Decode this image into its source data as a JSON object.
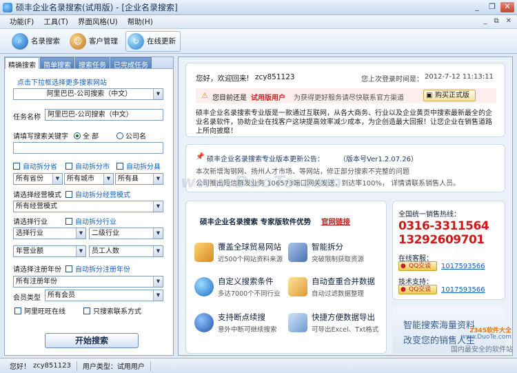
{
  "window": {
    "title": "硕丰企业名录搜索(试用版) - [企业名录搜索]"
  },
  "window_controls": {
    "minimize": "_",
    "restore": "❐",
    "close": "✕"
  },
  "menu": {
    "items": [
      "功能(F)",
      "工具(T)",
      "界面风格(U)",
      "帮助(H)"
    ],
    "right_controls": {
      "minimize": "_",
      "restore": "⧉",
      "close": "✕"
    }
  },
  "toolbar": {
    "buttons": [
      {
        "label": "名录搜索",
        "icon": "search-globe-icon"
      },
      {
        "label": "客户管理",
        "icon": "customers-icon"
      },
      {
        "label": "在线更新",
        "icon": "update-globe-icon"
      }
    ]
  },
  "left": {
    "tabs": [
      "精确搜索",
      "简单搜索",
      "搜索任务",
      "已完成任务"
    ],
    "hint_link": "点击下拉框选择更多搜索网站",
    "site_select": "阿里巴巴-公司搜索（中文）",
    "task_name_label": "任务名称",
    "task_name_value": "阿里巴巴-公司搜索（中文）",
    "keyword_label": "请填写搜索关键字",
    "radio_all": "全 部",
    "radio_company": "公司名",
    "keyword_value": "",
    "auto_split_province": "自动拆分省",
    "auto_split_city": "自动拆分市",
    "auto_split_county": "自动拆分县",
    "province_select": "所有省份",
    "city_select": "所有城市",
    "county_select": "所有县",
    "business_mode_label": "请选择经营模式",
    "auto_split_business_mode": "自动拆分经营模式",
    "business_mode_select": "所有经营模式",
    "industry_label": "请选择行业",
    "auto_split_industry": "自动拆分行业",
    "industry1_select": "选择行业",
    "industry2_select": "二级行业",
    "revenue_select": "年营业额",
    "employees_select": "员工人数",
    "reg_year_label": "请选择注册年份",
    "auto_split_reg_year": "自动拆分注册年份",
    "reg_year_select": "所有注册年份",
    "member_type_label": "会员类型",
    "member_type_select": "所有会员",
    "aliwangwang_online": "阿里旺旺在线",
    "contact_only": "只搜索联系方式",
    "start_button": "开始搜索"
  },
  "welcome": {
    "greeting": "您好，欢迎回来!",
    "username": "zcy851123",
    "last_login_label": "您上次登录时间是：",
    "last_login_time": "2012-7-12 11:13:11",
    "trial_prefix": "您目前还是",
    "trial_version": "试用版用户",
    "trial_suffix": "为获得更好服务请尽快联系官方渠道",
    "buy_button": "购买正式版",
    "intro": "硕丰企业名录搜索专业版是一款通过互联网，从各大商务、行业以及企业黄页中搜索最新最全的企业名录软件，协助企业在找客户这块提高效率减少成本，为企创造最大回报！让您企业在销售道路上所向披靡！"
  },
  "notice": {
    "title": "硕丰企业名录搜索专业版本更新公告：",
    "version": "（版本号Ver1.2.07.26）",
    "line1": "本次新增淘钢网、扬州人才市场、等网站，修正部分搜索不完整的问题",
    "line2": "公司推出短信群发业务 106573端口网关发送，到达率100%， 详情请联系销售人员。"
  },
  "features": {
    "heading": "硕丰企业名录搜索  专家版软件优势",
    "official_link": "官网链接",
    "items": [
      {
        "title": "覆盖全球贸易网站",
        "sub": "近500个网站资料来源",
        "icon": "chart-icon",
        "color": "#e3a53a"
      },
      {
        "title": "智能拆分",
        "sub": "突破限制获取资源",
        "icon": "person-icon",
        "color": "#6a8fc2"
      },
      {
        "title": "自定义搜索条件",
        "sub": "多达7000个不同行业",
        "icon": "globe-icon",
        "color": "#3b86d6"
      },
      {
        "title": "自动查重合并数据",
        "sub": "自动过滤数据整理",
        "icon": "document-icon",
        "color": "#e8b14f"
      },
      {
        "title": "支持断点续搜",
        "sub": "意外中断可继续搜索",
        "icon": "magnifier-icon",
        "color": "#3d78c4"
      },
      {
        "title": "快捷方便数据导出",
        "sub": "可导出Excel、Txt格式",
        "icon": "export-icon",
        "color": "#7ea7d6"
      }
    ]
  },
  "contact": {
    "hotline_label": "全国统一销售热线：",
    "phone1": "0316-3311564",
    "phone2": "13292609701",
    "online_service_label": "在线客服：",
    "qq_badge": "QQ交谈",
    "qq_number": "1017593566",
    "tech_support_label": "技术支持：",
    "qq_badge2": "QQ交谈",
    "qq_number2": "1017593566"
  },
  "slogan": {
    "line1": "智能搜索海量资料",
    "line2": "改变您的销售人生"
  },
  "watermark": "www.DuoTe.com",
  "corner_watermark": {
    "line1": "2345软件大全",
    "line2": "www.DuoTe.com",
    "line3": "国内最安全的软件站"
  },
  "statusbar": {
    "greeting": "您好！",
    "username": "zcy851123",
    "user_type": "用户类型：试用用户"
  },
  "colors": {
    "accent": "#1060c0",
    "phone_red": "#d01818",
    "trial_red": "#d42020"
  }
}
